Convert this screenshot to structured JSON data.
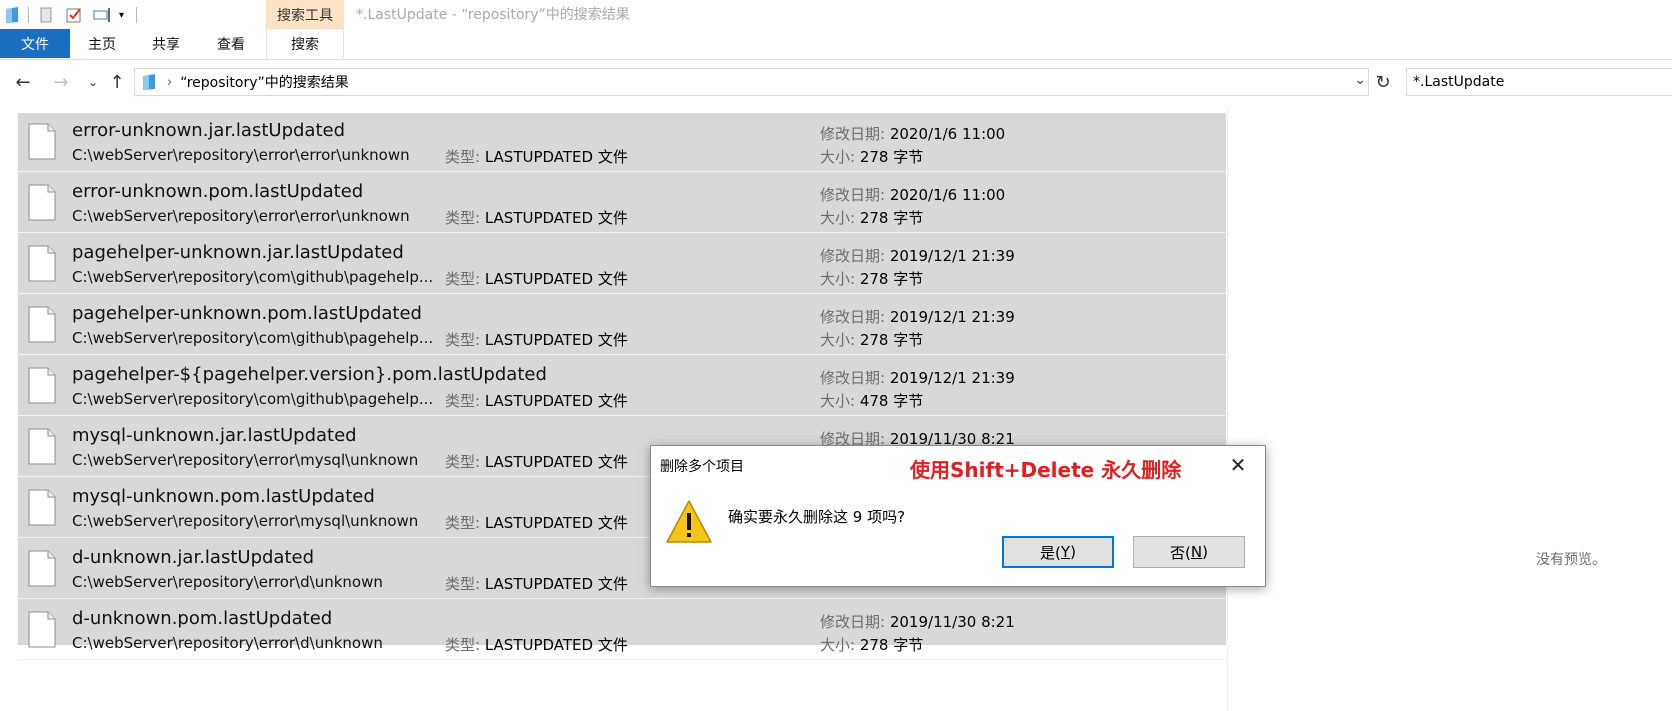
{
  "window": {
    "title": "*.LastUpdate - “repository”中的搜索结果",
    "context_tab_header": "搜索工具"
  },
  "ribbon": {
    "tabs": [
      "文件",
      "主页",
      "共享",
      "查看",
      "搜索"
    ]
  },
  "address": {
    "path": "“repository”中的搜索结果",
    "search_value": "*.LastUpdate"
  },
  "labels": {
    "modified": "修改日期:",
    "size": "大小:",
    "type": "类型:"
  },
  "files": [
    {
      "name": "error-unknown.jar.lastUpdated",
      "path": "C:\\webServer\\repository\\error\\error\\unknown",
      "type": "LASTUPDATED 文件",
      "modified": "2020/1/6 11:00",
      "size": "278 字节"
    },
    {
      "name": "error-unknown.pom.lastUpdated",
      "path": "C:\\webServer\\repository\\error\\error\\unknown",
      "type": "LASTUPDATED 文件",
      "modified": "2020/1/6 11:00",
      "size": "278 字节"
    },
    {
      "name": "pagehelper-unknown.jar.lastUpdated",
      "path": "C:\\webServer\\repository\\com\\github\\pagehelp...",
      "type": "LASTUPDATED 文件",
      "modified": "2019/12/1 21:39",
      "size": "278 字节"
    },
    {
      "name": "pagehelper-unknown.pom.lastUpdated",
      "path": "C:\\webServer\\repository\\com\\github\\pagehelp...",
      "type": "LASTUPDATED 文件",
      "modified": "2019/12/1 21:39",
      "size": "278 字节"
    },
    {
      "name": "pagehelper-${pagehelper.version}.pom.lastUpdated",
      "path": "C:\\webServer\\repository\\com\\github\\pagehelp...",
      "type": "LASTUPDATED 文件",
      "modified": "2019/12/1 21:39",
      "size": "478 字节"
    },
    {
      "name": "mysql-unknown.jar.lastUpdated",
      "path": "C:\\webServer\\repository\\error\\mysql\\unknown",
      "type": "LASTUPDATED 文件",
      "modified": "2019/11/30 8:21",
      "size": ""
    },
    {
      "name": "mysql-unknown.pom.lastUpdated",
      "path": "C:\\webServer\\repository\\error\\mysql\\unknown",
      "type": "LASTUPDATED 文件",
      "modified": "",
      "size": ""
    },
    {
      "name": "d-unknown.jar.lastUpdated",
      "path": "C:\\webServer\\repository\\error\\d\\unknown",
      "type": "LASTUPDATED 文件",
      "modified": "",
      "size": ""
    },
    {
      "name": "d-unknown.pom.lastUpdated",
      "path": "C:\\webServer\\repository\\error\\d\\unknown",
      "type": "LASTUPDATED 文件",
      "modified": "2019/11/30 8:21",
      "size": "278 字节"
    }
  ],
  "preview": {
    "text": "没有预览。"
  },
  "dialog": {
    "title": "删除多个项目",
    "annotation": "使用Shift+Delete 永久删除",
    "message": "确实要永久删除这 9 项吗?",
    "yes_label": "是(",
    "yes_key": "Y",
    "yes_suffix": ")",
    "no_label": "否(",
    "no_key": "N",
    "no_suffix": ")"
  },
  "colors": {
    "file_tab": "#1a6ec0",
    "context_tab": "#fde3c6",
    "selection": "#d8d8d8",
    "annotation": "#e02020",
    "focus_border": "#0078d7"
  }
}
